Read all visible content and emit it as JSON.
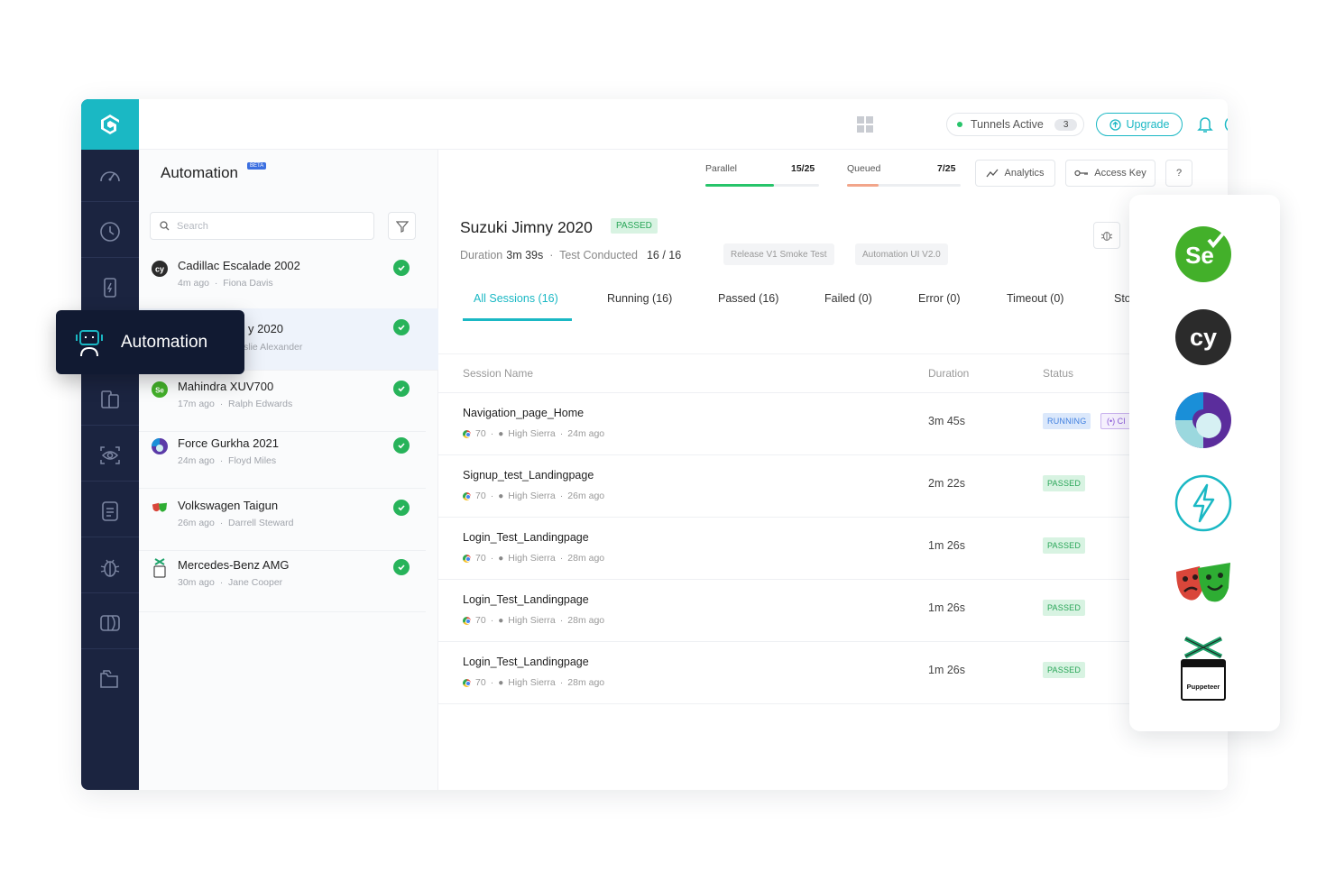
{
  "header": {
    "tunnels_label": "Tunnels Active",
    "tunnels_count": "3",
    "upgrade_label": "Upgrade"
  },
  "list": {
    "title": "Automation",
    "beta": "BETA",
    "search_placeholder": "Search",
    "items": [
      {
        "name": "Cadillac Escalade 2002",
        "time": "4m ago",
        "user": "Fiona Davis",
        "icon": "cypress-icon"
      },
      {
        "name": "y 2020",
        "time": "",
        "user": "slie Alexander",
        "icon": "hidden-icon"
      },
      {
        "name": "Mahindra XUV700",
        "time": "17m ago",
        "user": "Ralph Edwards",
        "icon": "selenium-icon"
      },
      {
        "name": "Force Gurkha 2021",
        "time": "24m ago",
        "user": "Floyd Miles",
        "icon": "hyperexecute-icon"
      },
      {
        "name": "Volkswagen Taigun",
        "time": "26m ago",
        "user": "Darrell Steward",
        "icon": "playwright-icon"
      },
      {
        "name": "Mercedes-Benz AMG",
        "time": "30m ago",
        "user": "Jane Cooper",
        "icon": "puppeteer-icon"
      }
    ]
  },
  "stats": {
    "parallel_label": "Parallel",
    "parallel_value": "15/25",
    "parallel_fraction": 0.6,
    "queued_label": "Queued",
    "queued_value": "7/25",
    "queued_fraction": 0.28,
    "analytics_label": "Analytics",
    "access_key_label": "Access Key",
    "help_label": "?"
  },
  "build": {
    "title": "Suzuki Jimny 2020",
    "status": "PASSED",
    "duration_label": "Duration",
    "duration_value": "3m 39s",
    "tests_label": "Test Conducted",
    "tests_value": "16 / 16",
    "tags": [
      "Release V1 Smoke Test",
      "Automation UI V2.0"
    ]
  },
  "tabs": [
    {
      "label": "All Sessions (16)",
      "active": true
    },
    {
      "label": "Running (16)",
      "active": false
    },
    {
      "label": "Passed (16)",
      "active": false
    },
    {
      "label": "Failed (0)",
      "active": false
    },
    {
      "label": "Error (0)",
      "active": false
    },
    {
      "label": "Timeout (0)",
      "active": false
    },
    {
      "label": "Sto",
      "active": false
    }
  ],
  "table": {
    "headers": [
      "Session Name",
      "Duration",
      "Status"
    ],
    "rows": [
      {
        "name": "Navigation_page_Home",
        "browser": "70",
        "os": "High Sierra",
        "ago": "24m ago",
        "duration": "3m 45s",
        "status": "RUNNING",
        "extra": "(•) CI"
      },
      {
        "name": "Signup_test_Landingpage",
        "browser": "70",
        "os": "High Sierra",
        "ago": "26m ago",
        "duration": "2m 22s",
        "status": "PASSED"
      },
      {
        "name": "Login_Test_Landingpage",
        "browser": "70",
        "os": "High Sierra",
        "ago": "28m ago",
        "duration": "1m 26s",
        "status": "PASSED"
      },
      {
        "name": "Login_Test_Landingpage",
        "browser": "70",
        "os": "High Sierra",
        "ago": "28m ago",
        "duration": "1m 26s",
        "status": "PASSED"
      },
      {
        "name": "Login_Test_Landingpage",
        "browser": "70",
        "os": "High Sierra",
        "ago": "28m ago",
        "duration": "1m 26s",
        "status": "PASSED"
      }
    ]
  },
  "tooltip": {
    "label": "Automation"
  },
  "frameworks": {
    "selenium": "Se",
    "cypress": "cy",
    "puppeteer": "Puppeteer"
  },
  "colors": {
    "accent": "#1ab8c4",
    "rail": "#1b2440",
    "passed": "#28a557",
    "running": "#3f7fe0"
  }
}
